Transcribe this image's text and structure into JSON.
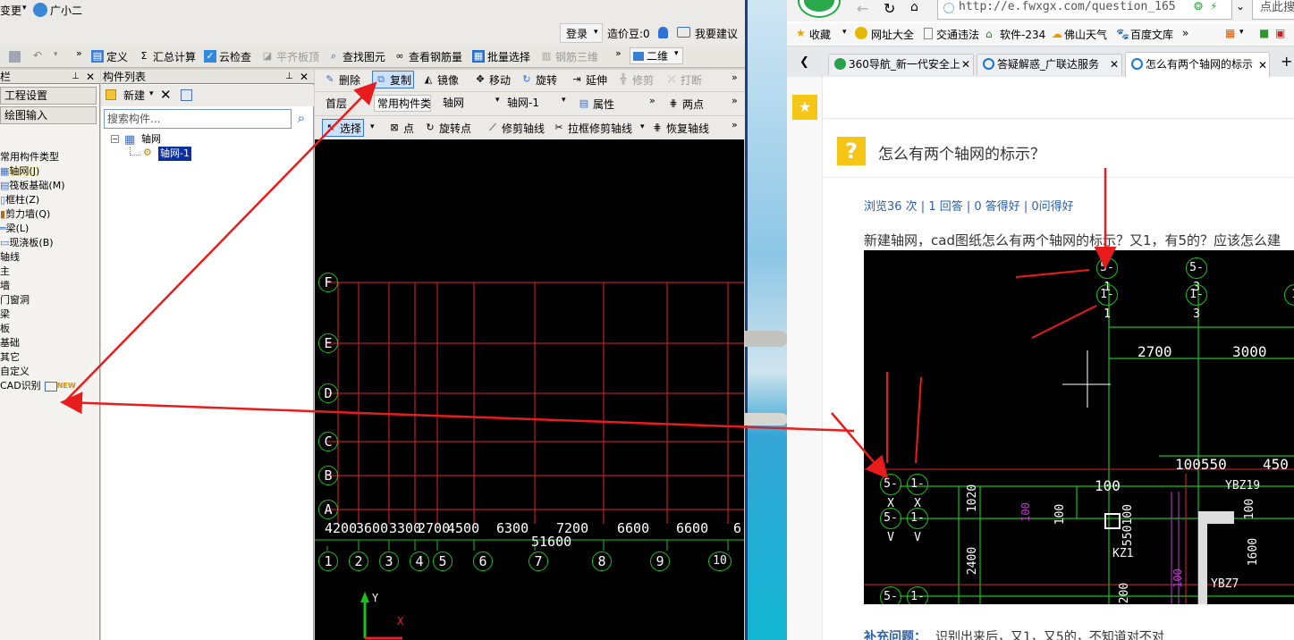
{
  "topbar": {
    "menu_change": "变更",
    "assistant": "广小二",
    "login": "登录",
    "cost_beans": "造价豆:0",
    "suggest": "我要建议"
  },
  "toolbar1": {
    "define": "定义",
    "summary": "汇总计算",
    "cloud_check": "云检查",
    "flat_top": "平齐板顶",
    "find_element": "查找图元",
    "view_rebar": "查看钢筋量",
    "batch_select": "批量选择",
    "rebar_3d": "钢筋三维",
    "view_mode": "二维"
  },
  "left_panel": {
    "title": "栏",
    "project_settings": "工程设置",
    "drawing_input": "绘图输入",
    "tree": [
      "常用构件类型",
      "轴网(J)",
      "筏板基础(M)",
      "框柱(Z)",
      "剪力墙(Q)",
      "梁(L)",
      "现浇板(B)",
      "轴线",
      "主",
      "墙",
      "门窗洞",
      "梁",
      "板",
      "基础",
      "其它",
      "自定义",
      "CAD识别"
    ],
    "new_badge": "NEW"
  },
  "component_list": {
    "title": "构件列表",
    "new_btn": "新建",
    "search_placeholder": "搜索构件...",
    "root": "轴网",
    "child": "轴网-1"
  },
  "edit_toolbar": {
    "delete": "删除",
    "copy": "复制",
    "mirror": "镜像",
    "move": "移动",
    "rotate": "旋转",
    "extend": "延伸",
    "trim": "修剪",
    "break": "打断"
  },
  "layer_toolbar": {
    "floor": "首层",
    "component_type": "常用构件类",
    "axis_type": "轴网",
    "axis_name": "轴网-1",
    "properties": "属性",
    "two_points": "两点"
  },
  "draw_toolbar": {
    "select": "选择",
    "point": "点",
    "rotate_point": "旋转点",
    "trim_axis": "修剪轴线",
    "box_trim": "拉框修剪轴线",
    "restore_axis": "恢复轴线"
  },
  "cad_canvas": {
    "row_labels": [
      "F",
      "E",
      "D",
      "C",
      "B",
      "A"
    ],
    "col_labels": [
      "1",
      "2",
      "3",
      "4",
      "5",
      "6",
      "7",
      "8",
      "9",
      "10"
    ],
    "spacings": [
      "4200",
      "3600",
      "3300",
      "2700",
      "4500",
      "6300",
      "7200",
      "6600",
      "6600",
      "6"
    ],
    "total": "51600",
    "axis_y": "Y",
    "axis_x": "X"
  },
  "browser": {
    "url": "http://e.fwxgx.com/question_165",
    "addr_hint": "点此搜",
    "bookmarks": [
      "收藏",
      "网址大全",
      "交通违法",
      "软件-234",
      "佛山天气",
      "百度文库"
    ],
    "tabs": [
      "360导航_新一代安全上",
      "答疑解惑_广联达服务",
      "怎么有两个轴网的标示"
    ],
    "question_title": "怎么有两个轴网的标示？",
    "stats": "浏览36 次 | 1 回答 | 0 答得好 | 0问得好",
    "question_text": "新建轴网，cad图纸怎么有两个轴网的标示？又1，有5的？应该怎么建",
    "supplement_label": "补充问题：",
    "supplement_text": "识别出来后，又1，又5的，不知道对不对",
    "image_labels": [
      "5-1",
      "5-3",
      "1-1",
      "1-3",
      "1",
      "5-X",
      "1-X",
      "5-V",
      "1-V",
      "5-S",
      "1-S"
    ],
    "image_dims": [
      "2700",
      "3000",
      "100",
      "100550",
      "450",
      "1020",
      "2400",
      "100",
      "550100",
      "200",
      "1600",
      "100",
      "100",
      "100"
    ],
    "image_tags": [
      "KZ1",
      "YBZ19",
      "YBZ7"
    ]
  },
  "colors": {
    "annotation_arrow": "#e81c1c",
    "grid_red": "#e0262b",
    "grid_green": "#19c319",
    "cad_bg": "#000000"
  }
}
